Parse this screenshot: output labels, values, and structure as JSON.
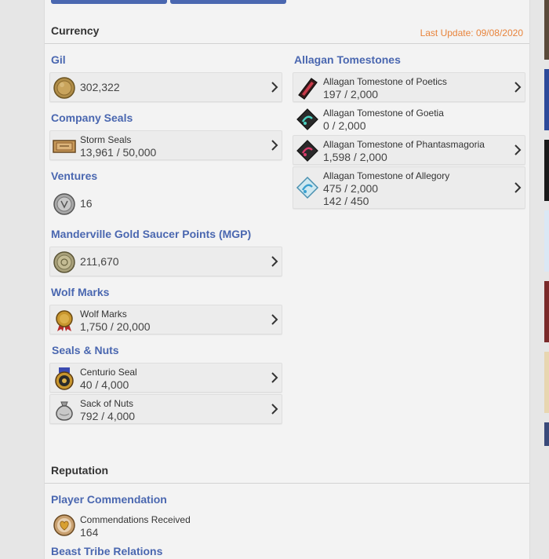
{
  "currency": {
    "title": "Currency",
    "last_update": "Last Update: 09/08/2020",
    "gil": {
      "label": "Gil",
      "value": "302,322"
    },
    "company_seals": {
      "label": "Company Seals",
      "item": "Storm Seals",
      "value": "13,961 / 50,000"
    },
    "ventures": {
      "label": "Ventures",
      "value": "16"
    },
    "mgp": {
      "label": "Manderville Gold Saucer Points (MGP)",
      "value": "211,670"
    },
    "wolf_marks": {
      "label": "Wolf Marks",
      "item": "Wolf Marks",
      "value": "1,750 / 20,000"
    },
    "seals_nuts": {
      "label": "Seals & Nuts",
      "items": [
        {
          "name": "Centurio Seal",
          "value": "40 / 4,000"
        },
        {
          "name": "Sack of Nuts",
          "value": "792 / 4,000"
        }
      ]
    },
    "tomestones": {
      "label": "Allagan Tomestones",
      "items": [
        {
          "name": "Allagan Tomestone of Poetics",
          "value": "197 / 2,000"
        },
        {
          "name": "Allagan Tomestone of Goetia",
          "value": "0 / 2,000"
        },
        {
          "name": "Allagan Tomestone of Phantasmagoria",
          "value": "1,598 / 2,000"
        },
        {
          "name": "Allagan Tomestone of Allegory",
          "value": "475 / 2,000",
          "value2": "142 / 450"
        }
      ]
    }
  },
  "reputation": {
    "title": "Reputation",
    "player_commendation": {
      "label": "Player Commendation",
      "item": "Commendations Received",
      "value": "164"
    },
    "beast_tribe": {
      "label": "Beast Tribe Relations"
    }
  },
  "icons": {
    "gil": "gil-coin-icon",
    "storm_seals": "storm-seals-icon",
    "ventures": "venture-coin-icon",
    "mgp": "mgp-coin-icon",
    "wolf_marks": "wolf-mark-medal-icon",
    "centurio": "centurio-seal-icon",
    "nuts": "sack-of-nuts-icon",
    "tomestone": "tomestone-icon",
    "commendation": "commendation-heart-icon",
    "chevron": "chevron-right-icon"
  },
  "colors": {
    "accent": "#4a67b0",
    "update": "#e8843c",
    "panel": "#f3f3f3"
  }
}
